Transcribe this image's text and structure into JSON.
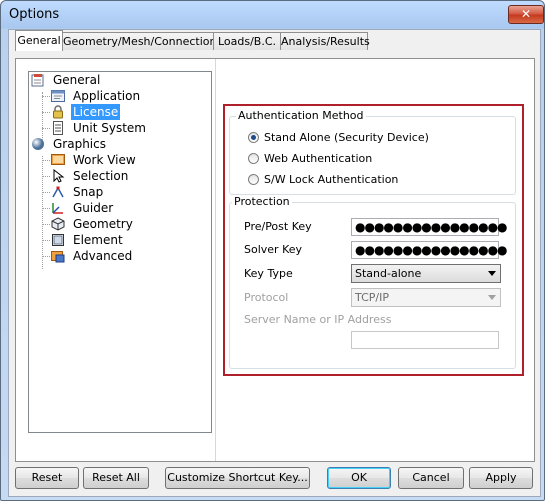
{
  "window": {
    "title": "Options",
    "close_glyph": "✕"
  },
  "tabs": [
    {
      "label": "General",
      "active": true
    },
    {
      "label": "Geometry/Mesh/Connections",
      "active": false
    },
    {
      "label": "Loads/B.C.",
      "active": false
    },
    {
      "label": "Analysis/Results",
      "active": false
    }
  ],
  "tree": {
    "general": "General",
    "items_general": [
      {
        "label": "Application",
        "icon": "application-icon"
      },
      {
        "label": "License",
        "icon": "lock-icon",
        "selected": true
      },
      {
        "label": "Unit System",
        "icon": "unit-system-icon"
      }
    ],
    "graphics": "Graphics",
    "items_graphics": [
      {
        "label": "Work View",
        "icon": "work-view-icon"
      },
      {
        "label": "Selection",
        "icon": "selection-icon"
      },
      {
        "label": "Snap",
        "icon": "snap-icon"
      },
      {
        "label": "Guider",
        "icon": "guider-icon"
      },
      {
        "label": "Geometry",
        "icon": "geometry-icon"
      },
      {
        "label": "Element",
        "icon": "element-icon"
      },
      {
        "label": "Advanced",
        "icon": "advanced-icon"
      }
    ]
  },
  "auth": {
    "group_label": "Authentication Method",
    "options": [
      {
        "label": "Stand Alone (Security Device)",
        "checked": true
      },
      {
        "label": "Web Authentication",
        "checked": false
      },
      {
        "label": "S/W Lock Authentication",
        "checked": false
      }
    ]
  },
  "protection": {
    "group_label": "Protection",
    "prepost_label": "Pre/Post Key",
    "prepost_value": "●●●●●●●●●●●●●●●●",
    "solver_label": "Solver Key",
    "solver_value": "●●●●●●●●●●●●●●●●",
    "keytype_label": "Key Type",
    "keytype_value": "Stand-alone",
    "protocol_label": "Protocol",
    "protocol_value": "TCP/IP",
    "server_label": "Server Name or IP Address",
    "server_value": ""
  },
  "buttons": {
    "reset": "Reset",
    "reset_all": "Reset All",
    "customize": "Customize Shortcut Key...",
    "ok": "OK",
    "cancel": "Cancel",
    "apply": "Apply"
  },
  "colors": {
    "highlight": "#b0202a",
    "selection": "#3399ff"
  }
}
